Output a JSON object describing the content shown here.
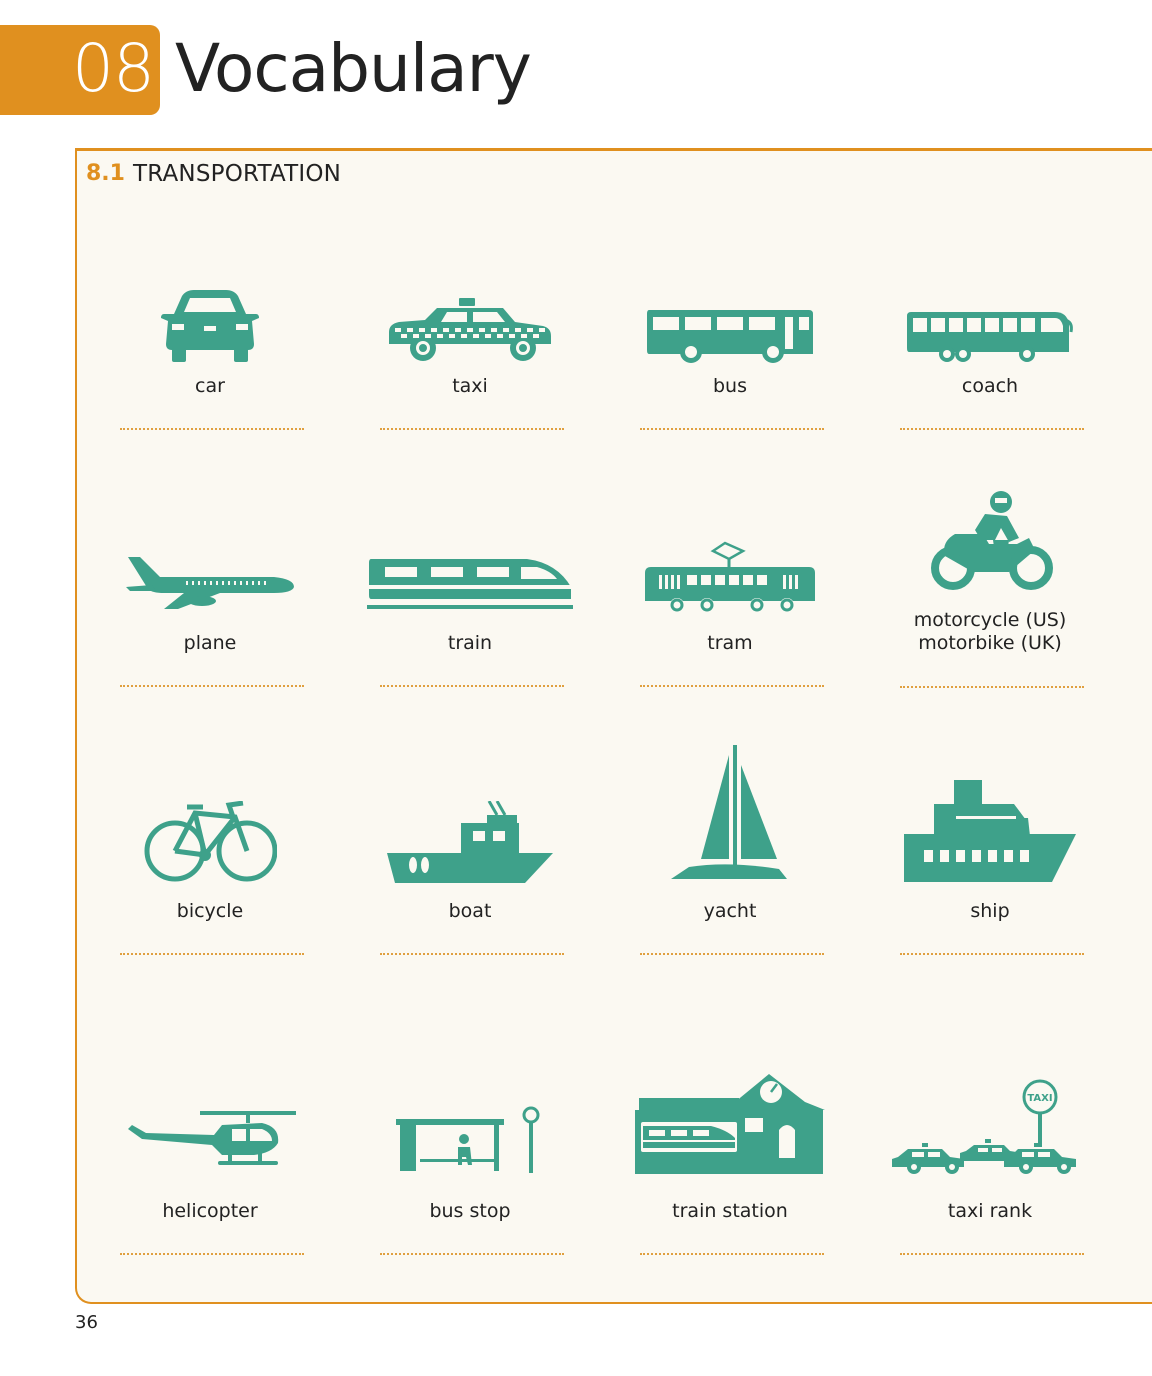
{
  "header": {
    "chapter_number": "08",
    "title": "Vocabulary"
  },
  "section": {
    "number": "8.1",
    "title": "TRANSPORTATION"
  },
  "items": [
    {
      "label": "car",
      "icon": "car-icon"
    },
    {
      "label": "taxi",
      "icon": "taxi-icon"
    },
    {
      "label": "bus",
      "icon": "bus-icon"
    },
    {
      "label": "coach",
      "icon": "coach-icon"
    },
    {
      "label": "plane",
      "icon": "plane-icon"
    },
    {
      "label": "train",
      "icon": "train-icon"
    },
    {
      "label": "tram",
      "icon": "tram-icon"
    },
    {
      "label": "motorcycle (US)\nmotorbike (UK)",
      "icon": "motorcycle-icon"
    },
    {
      "label": "bicycle",
      "icon": "bicycle-icon"
    },
    {
      "label": "boat",
      "icon": "boat-icon"
    },
    {
      "label": "yacht",
      "icon": "yacht-icon"
    },
    {
      "label": "ship",
      "icon": "ship-icon"
    },
    {
      "label": "helicopter",
      "icon": "helicopter-icon"
    },
    {
      "label": "bus stop",
      "icon": "bus-stop-icon"
    },
    {
      "label": "train station",
      "icon": "train-station-icon"
    },
    {
      "label": "taxi rank",
      "icon": "taxi-rank-icon",
      "sign_text": "TAXI"
    }
  ],
  "page_number": "36",
  "colors": {
    "accent": "#e0901f",
    "icon": "#3ea18a",
    "panel": "#fbf9f2"
  }
}
